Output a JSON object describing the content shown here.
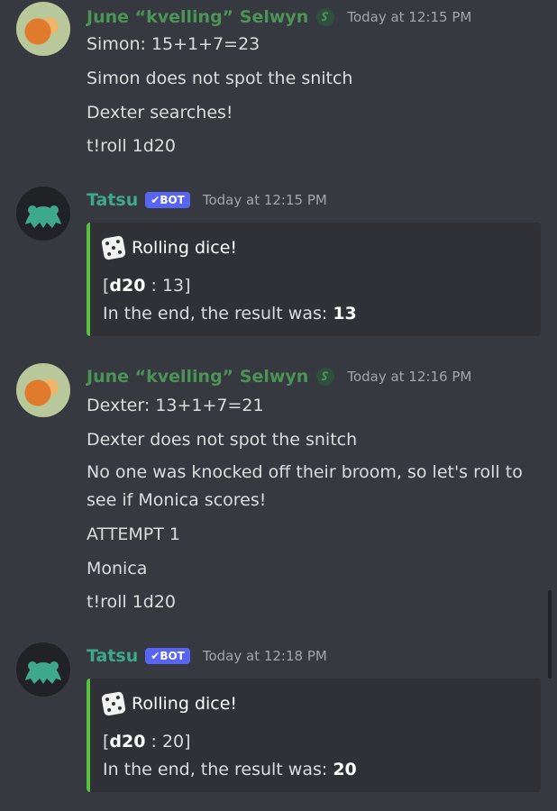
{
  "messages": [
    {
      "author": "June “kvelling” Selwyn",
      "timestamp": "Today at 12:15 PM",
      "lines": [
        "Simon: 15+1+7=23",
        "Simon does not spot the snitch",
        "Dexter searches!",
        "t!roll 1d20"
      ]
    },
    {
      "author": "Tatsu",
      "bot_tag": "✔BOT",
      "timestamp": "Today at 12:15 PM",
      "embed": {
        "title": "Rolling dice!",
        "roll_open": "[",
        "die": "d20",
        "roll_sep": " : ",
        "roll_value": "13",
        "roll_close": "]",
        "result_prefix": "In the end, the result was: ",
        "result": "13"
      }
    },
    {
      "author": "June “kvelling” Selwyn",
      "timestamp": "Today at 12:16 PM",
      "lines": [
        "Dexter: 13+1+7=21",
        "Dexter does not spot the snitch",
        "No one was knocked off their broom, so let's roll to see if Monica scores!",
        "ATTEMPT 1",
        "Monica",
        "t!roll 1d20"
      ]
    },
    {
      "author": "Tatsu",
      "bot_tag": "✔BOT",
      "timestamp": "Today at 12:18 PM",
      "embed": {
        "title": "Rolling dice!",
        "roll_open": "[",
        "die": "d20",
        "roll_sep": " : ",
        "roll_value": "20",
        "roll_close": "]",
        "result_prefix": "In the end, the result was: ",
        "result": "20"
      }
    }
  ],
  "colors": {
    "background": "#36393f",
    "embed_bg": "#2f3136",
    "embed_accent": "#57c23d",
    "june_name": "#4c9455",
    "tatsu_name": "#3ea88b",
    "bot_tag": "#5865f2"
  },
  "icons": [
    "slytherin-role-icon",
    "die-icon",
    "bot-check-icon"
  ]
}
